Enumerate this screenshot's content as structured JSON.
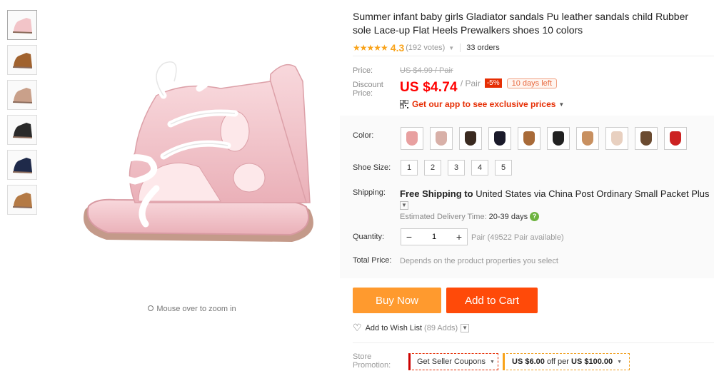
{
  "thumbnails": [
    {
      "name": "pink-sandal-thumb",
      "color": "#f2c4c8"
    },
    {
      "name": "brown-sandal-thumb",
      "color": "#a0622e"
    },
    {
      "name": "color-chart-thumb",
      "color": "#c9a08a"
    },
    {
      "name": "black-sandal-thumb",
      "color": "#2a2a2a"
    },
    {
      "name": "navy-sandal-thumb",
      "color": "#1f2a4a"
    },
    {
      "name": "tan-sandal-thumb",
      "color": "#b47a45"
    }
  ],
  "zoom_hint": "Mouse over to zoom in",
  "product": {
    "title": "Summer infant baby girls Gladiator sandals Pu leather sandals child Rubber sole Lace-up Flat Heels Prewalkers shoes 10 colors",
    "stars": "★★★★★",
    "rating": "4.3",
    "votes": "(192 votes)",
    "orders": "33 orders"
  },
  "price": {
    "price_label": "Price:",
    "old_price": "US $4.99 / Pair",
    "discount_label": "Discount Price:",
    "new_price": "US $4.74",
    "unit": "/ Pair",
    "off_badge": "-5%",
    "days_left": "10 days left",
    "app_link": "Get our app to see exclusive prices"
  },
  "options": {
    "color_label": "Color:",
    "colors": [
      "#e8a0a0",
      "#d8b0a8",
      "#3a2a20",
      "#1a1a2a",
      "#a86a38",
      "#222222",
      "#c89060",
      "#e8d0c0",
      "#6a4a30",
      "#cc2222"
    ],
    "size_label": "Shoe Size:",
    "sizes": [
      "1",
      "2",
      "3",
      "4",
      "5"
    ]
  },
  "shipping": {
    "label": "Shipping:",
    "free": "Free Shipping to",
    "dest": "United States via China Post Ordinary Small Packet Plus",
    "est_label": "Estimated Delivery Time:",
    "est_days": "20-39 days"
  },
  "quantity": {
    "label": "Quantity:",
    "value": "1",
    "available": "Pair (49522 Pair available)"
  },
  "total": {
    "label": "Total Price:",
    "value": "Depends on the product properties you select"
  },
  "actions": {
    "buy_now": "Buy Now",
    "add_to_cart": "Add to Cart",
    "wishlist": "Add to Wish List",
    "wishlist_count": "(89 Adds)"
  },
  "promotion": {
    "label": "Store Promotion:",
    "coupon_btn": "Get Seller Coupons",
    "offer_amount": "US $6.00",
    "offer_mid": "off per",
    "offer_min": "US $100.00"
  }
}
